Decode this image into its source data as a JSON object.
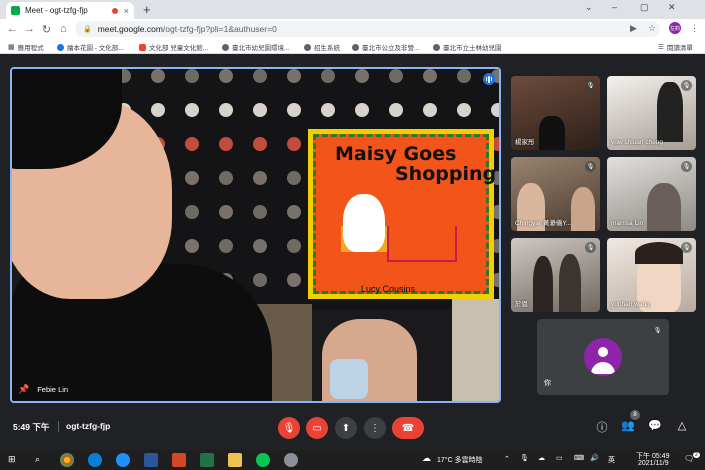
{
  "browser": {
    "tab_title": "Meet - ogt-tzfg-fjp",
    "tab_close": "×",
    "new_tab": "+",
    "url_host": "meet.google.com",
    "url_path": "/ogt-tzfg-fjp?pli=1&authuser=0",
    "profile_initials": "左鈞",
    "reading_list": "閱讀清單",
    "win_min": "–",
    "win_max": "▢",
    "win_close": "✕",
    "chevron": "⌄"
  },
  "bookmarks": [
    {
      "label": "應用程式",
      "color": "#4285f4"
    },
    {
      "label": "繪本花園 - 文化部...",
      "color": "#1a73e8"
    },
    {
      "label": "文化部 兒童文化館...",
      "color": "#ea4335"
    },
    {
      "label": "臺北市幼兒園環境...",
      "color": "#5f6368"
    },
    {
      "label": "招生系統",
      "color": "#5f6368"
    },
    {
      "label": "臺北市公立及非營...",
      "color": "#5f6368"
    },
    {
      "label": "臺北市立士林幼兒園",
      "color": "#5f6368"
    }
  ],
  "main": {
    "presenter_name": "Febie Lin",
    "book_title_1": "Maisy Goes",
    "book_title_2": "Shopping",
    "book_author": "Lucy Cousins"
  },
  "participants": [
    {
      "name": "楊家彤",
      "bg": "#6d4c3d"
    },
    {
      "name": "yow shiuan cheng",
      "bg": "#b9b0a8"
    },
    {
      "name": "Chingyar 黃瀞儀Y...",
      "bg": "#8a6f5a"
    },
    {
      "name": "marrisa Lin",
      "bg": "#c7c3c0"
    },
    {
      "name": "於恩",
      "bg": "#9b8e86"
    },
    {
      "name": "yunhan wang",
      "bg": "#d8cec6"
    }
  ],
  "self_tile": {
    "name": "你"
  },
  "controls": {
    "time": "5:49 下午",
    "meeting_code": "ogt-tzfg-fjp",
    "people_count": "8"
  },
  "taskbar": {
    "weather": "17°C 多雲時陰",
    "ime": "英",
    "time": "下午 05:49",
    "date": "2021/11/9",
    "notifications": "2"
  }
}
